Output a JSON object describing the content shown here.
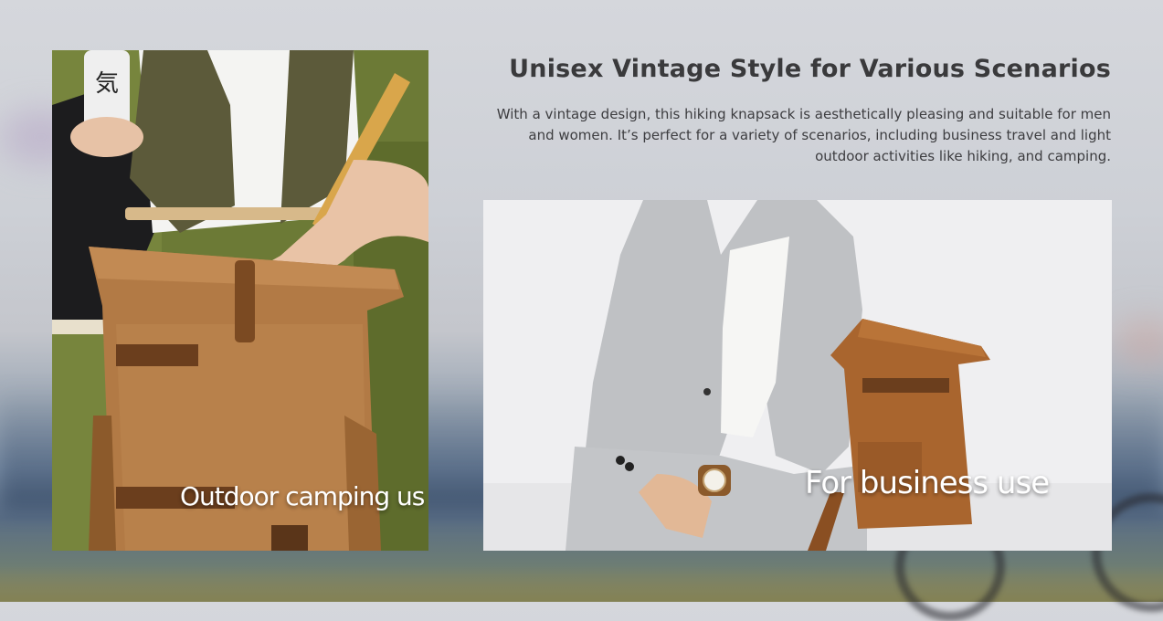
{
  "section": {
    "heading": "Unisex Vintage Style for Various Scenarios",
    "description": "With a vintage design, this hiking knapsack is aesthetically pleasing and suitable for men and women. It’s perfect for a variety of scenarios, including business travel and light outdoor activities like hiking, and camping."
  },
  "images": {
    "left": {
      "caption": "Outdoor camping us",
      "subject": "backpack-camping-photo"
    },
    "right": {
      "caption": "For business use",
      "subject": "backpack-business-photo"
    }
  },
  "colors": {
    "backpack": "#b27a45",
    "backpack_dark": "#7b4a22",
    "strap": "#6b3e1d",
    "suit": "#bfc1c4",
    "vest": "#5c5a3a",
    "grass": "#6f7d35",
    "text": "#3a3a3c"
  }
}
